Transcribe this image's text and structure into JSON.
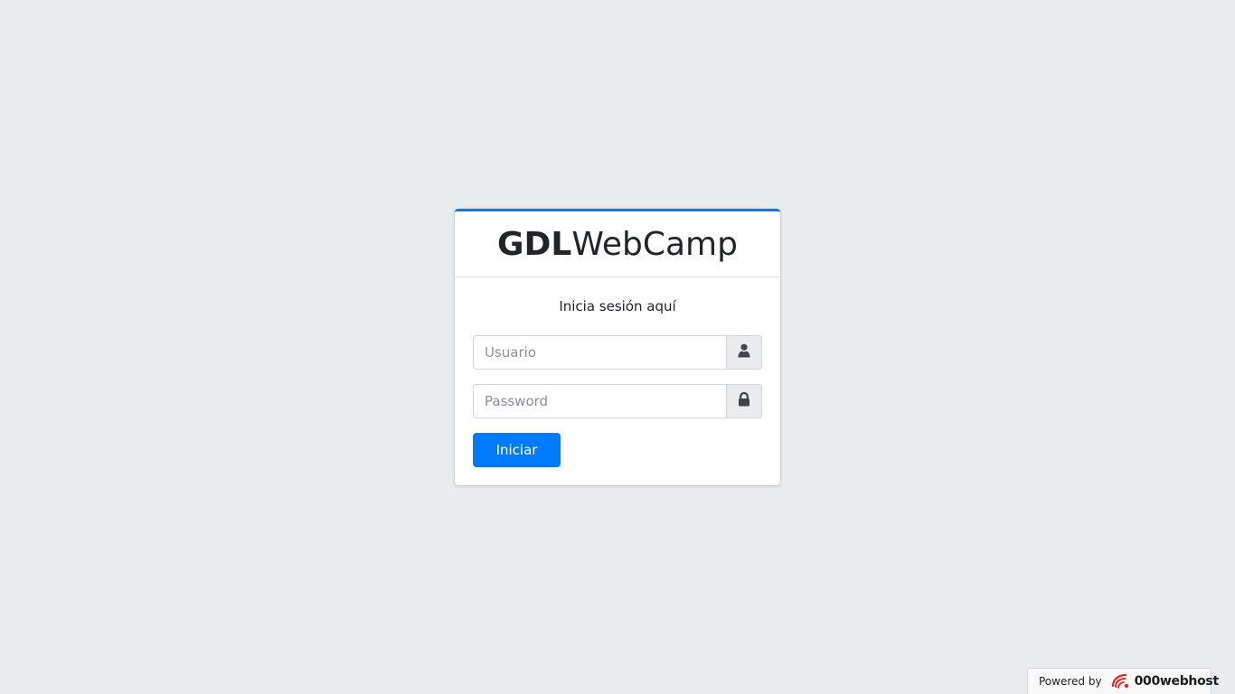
{
  "brand": {
    "bold": "GDL",
    "light": "WebCamp"
  },
  "login": {
    "message": "Inicia sesión aquí",
    "username": {
      "placeholder": "Usuario",
      "value": "",
      "icon": "user-icon"
    },
    "password": {
      "placeholder": "Password",
      "value": "",
      "icon": "lock-icon"
    },
    "submit_label": "Iniciar"
  },
  "footer": {
    "powered_label": "Powered by",
    "host_name": "000webhost",
    "icon": "000webhost-logo"
  },
  "colors": {
    "accent": "#007bff",
    "background": "#e9ecef",
    "logo_red": "#e0291f"
  }
}
